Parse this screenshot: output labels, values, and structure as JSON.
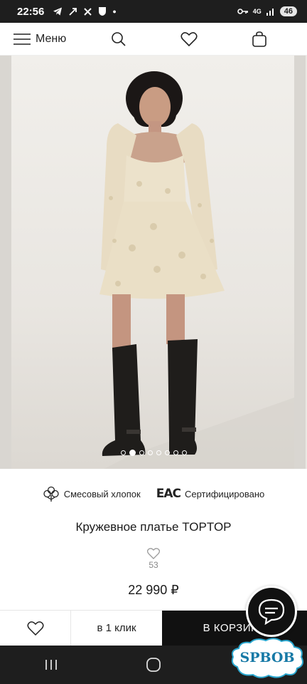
{
  "status_bar": {
    "time": "22:56",
    "network": "4G",
    "battery": "46"
  },
  "nav": {
    "menu_label": "Меню"
  },
  "gallery": {
    "slide_count": 8,
    "active_index": 2
  },
  "features": {
    "material": "Смесовый хлопок",
    "eac_mark": "ЕАС",
    "certified": "Сертифицировано"
  },
  "product": {
    "title": "Кружевное платье TOPTOP",
    "favorites_count": "53",
    "price": "22 990 ₽"
  },
  "actions": {
    "one_click": "в 1 клик",
    "add_to_cart": "В КОРЗИНУ"
  },
  "watermark": {
    "text": "SPBOB"
  }
}
